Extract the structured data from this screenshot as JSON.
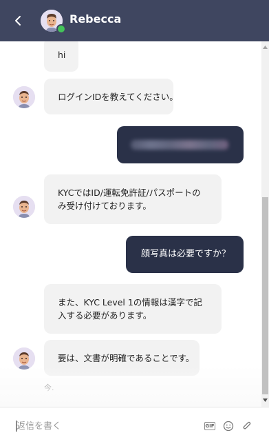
{
  "header": {
    "contact_name": "Rebecca",
    "status": "online",
    "background": "#3f4660"
  },
  "messages": [
    {
      "side": "in",
      "lines": [
        "hi"
      ],
      "avatar": false
    },
    {
      "side": "in",
      "lines": [
        "ログインIDを教えてください。"
      ],
      "avatar": true
    },
    {
      "side": "out",
      "lines": [],
      "redacted": true
    },
    {
      "side": "in",
      "lines": [
        "KYCではID/運転免許証/パスポートの",
        "み受け付けております。"
      ],
      "avatar": true
    },
    {
      "side": "out",
      "lines": [
        "顔写真は必要ですか？"
      ]
    },
    {
      "side": "in",
      "lines": [
        "また、KYC Level 1の情報は漢字で記",
        "入する必要があります。"
      ],
      "avatar": false
    },
    {
      "side": "in",
      "lines": [
        "要は、文書が明確であることです。"
      ],
      "avatar": true
    }
  ],
  "timestamp": "今.",
  "composer": {
    "placeholder": "返信を書く"
  },
  "icons": {
    "back": "chevron-left-icon",
    "gif": "gif-icon",
    "emoji": "emoji-icon",
    "attach": "paperclip-icon"
  },
  "colors": {
    "header": "#3f4660",
    "outgoing_bubble": "#2a3148",
    "incoming_bubble": "#f2f2f2",
    "online": "#44c35a"
  }
}
